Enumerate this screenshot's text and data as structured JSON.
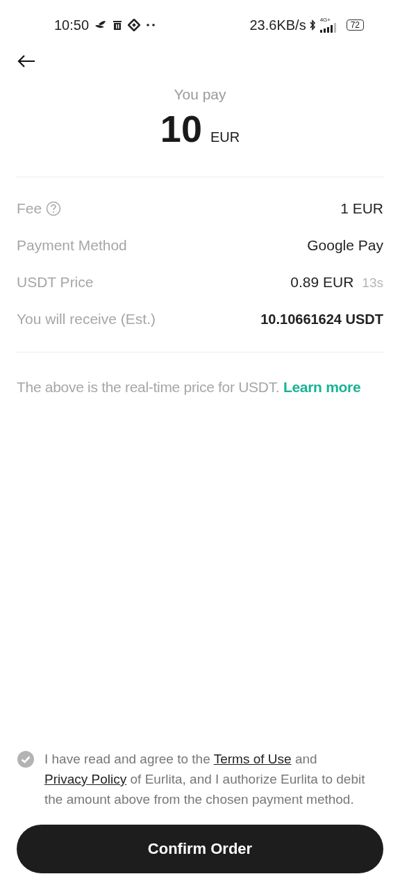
{
  "status_bar": {
    "time": "10:50",
    "speed": "23.6KB/s",
    "network": "4G+",
    "battery": "72"
  },
  "summary": {
    "label": "You pay",
    "amount": "10",
    "currency": "EUR"
  },
  "details": [
    {
      "label": "Fee",
      "help": true,
      "value": "1 EUR",
      "emphasis": false
    },
    {
      "label": "Payment Method",
      "help": false,
      "value": "Google Pay",
      "emphasis": false
    },
    {
      "label": "USDT Price",
      "help": false,
      "value": "0.89 EUR",
      "timer": "13s",
      "emphasis": false
    },
    {
      "label": "You will receive (Est.)",
      "help": false,
      "value": "10.10661624 USDT",
      "emphasis": true
    }
  ],
  "note": {
    "text": "The above is the real-time price for USDT.",
    "link": "Learn more"
  },
  "agreement": {
    "checked": false,
    "parts": [
      {
        "kind": "text",
        "text": "I have read and agree to the"
      },
      {
        "kind": "link",
        "text": "Terms of Use"
      },
      {
        "kind": "text",
        "text": "and"
      },
      {
        "kind": "link",
        "text": "Privacy Policy"
      },
      {
        "kind": "text",
        "text": "of Eurlita, and I authorize Eurlita to debit the amount above from the chosen payment method."
      }
    ]
  },
  "confirm_button": "Confirm Order"
}
